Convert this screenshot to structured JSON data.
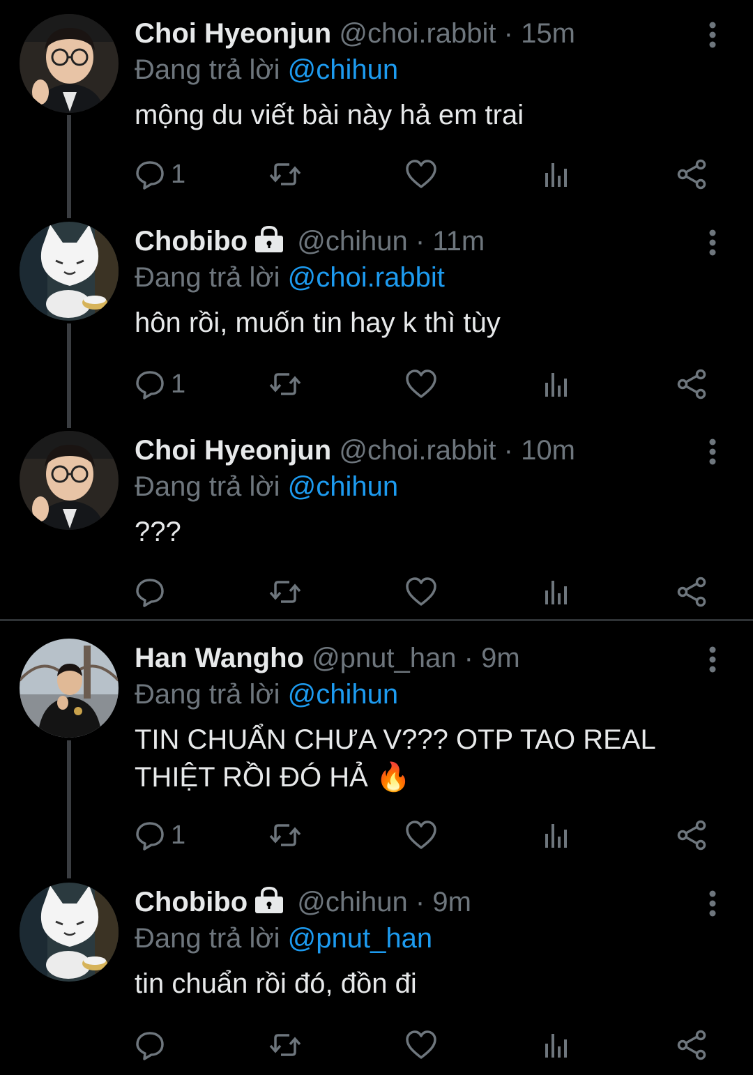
{
  "reply_prefix": "Đang trả lời",
  "colors": {
    "background": "#000000",
    "text": "#e7e9ea",
    "muted": "#6e767d",
    "accent": "#1d9bf0",
    "line": "#3a3d41"
  },
  "icons": {
    "reply": "comment-icon",
    "retweet": "retweet-icon",
    "like": "heart-icon",
    "views": "analytics-icon",
    "share": "share-icon",
    "more": "more-vertical-icon",
    "lock": "lock-icon"
  },
  "tweets": [
    {
      "name": "Choi Hyeonjun",
      "handle": "@choi.rabbit",
      "sep": "·",
      "time": "15m",
      "reply_to": "@chihun",
      "text": "mộng du viết bài này hả em trai",
      "reply_count": "1",
      "locked": false,
      "avatar": "person-glasses"
    },
    {
      "name": "Chobibo",
      "handle": "@chihun",
      "sep": "·",
      "time": "11m",
      "reply_to": "@choi.rabbit",
      "text": "hôn rồi, muốn tin hay k thì tùy",
      "reply_count": "1",
      "locked": true,
      "avatar": "white-cat"
    },
    {
      "name": "Choi Hyeonjun",
      "handle": "@choi.rabbit",
      "sep": "·",
      "time": "10m",
      "reply_to": "@chihun",
      "text": "???",
      "reply_count": "",
      "locked": false,
      "avatar": "person-glasses"
    },
    {
      "name": "Han Wangho",
      "handle": "@pnut_han",
      "sep": "·",
      "time": "9m",
      "reply_to": "@chihun",
      "text": "TIN CHUẨN CHƯA V??? OTP TAO REAL THIỆT RỒI ĐÓ HẢ 🔥",
      "reply_count": "1",
      "locked": false,
      "avatar": "person-bridge"
    },
    {
      "name": "Chobibo",
      "handle": "@chihun",
      "sep": "·",
      "time": "9m",
      "reply_to": "@pnut_han",
      "text": "tin chuẩn rồi đó, đồn đi",
      "reply_count": "",
      "locked": true,
      "avatar": "white-cat"
    }
  ]
}
